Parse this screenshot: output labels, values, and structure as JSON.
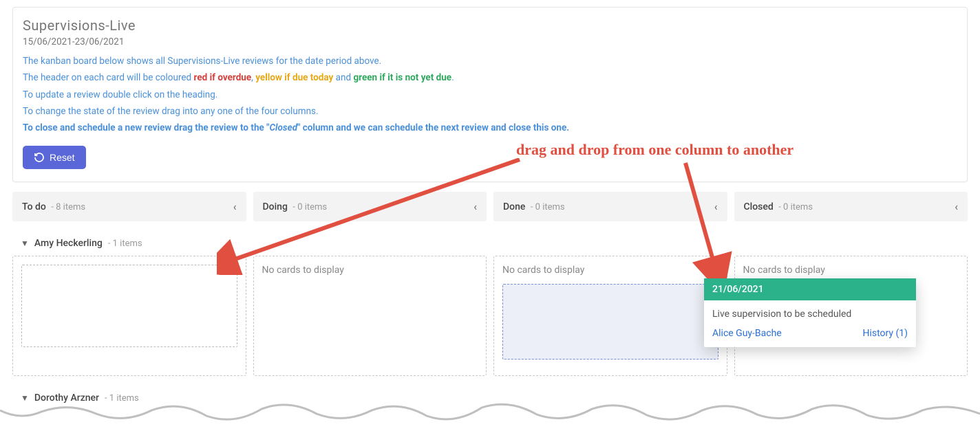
{
  "header": {
    "title": "Supervisions-Live",
    "date_range": "15/06/2021-23/06/2021",
    "line1_a": "The kanban board below shows all Supervisions-Live reviews for the date period above.",
    "line2_a": "The header on each card will be coloured ",
    "line2_red": "red if overdue",
    "line2_sep1": ", ",
    "line2_yellow": "yellow if due today",
    "line2_sep2": " and ",
    "line2_green": "green if it is not yet due",
    "line2_end": ".",
    "line3": "To update a review double click on the heading.",
    "line4": "To change the state of the review drag into any one of the four columns.",
    "line5_a": "To close and schedule a new review drag the review to the \"",
    "line5_closed": "Closed",
    "line5_b": "\" column and we can schedule the next review and close this one.",
    "reset_label": "Reset"
  },
  "columns": [
    {
      "name": "To do",
      "count": "- 8 items"
    },
    {
      "name": "Doing",
      "count": "- 0 items"
    },
    {
      "name": "Done",
      "count": "- 0 items"
    },
    {
      "name": "Closed",
      "count": "- 0 items"
    }
  ],
  "swimlanes": [
    {
      "name": "Amy Heckerling",
      "count": "- 1 items"
    },
    {
      "name": "Dorothy Arzner",
      "count": "- 1 items"
    }
  ],
  "no_cards_text": "No cards to display",
  "dragging_card": {
    "date": "21/06/2021",
    "body": "Live supervision to be scheduled",
    "assignee": "Alice Guy-Bache",
    "history": "History (1)"
  },
  "annotation": "drag and drop from one column to another",
  "colors": {
    "green_header": "#2bb28a",
    "link": "#2a6fd6",
    "annotation": "#e04f3f",
    "primary_btn": "#5a67d8"
  }
}
